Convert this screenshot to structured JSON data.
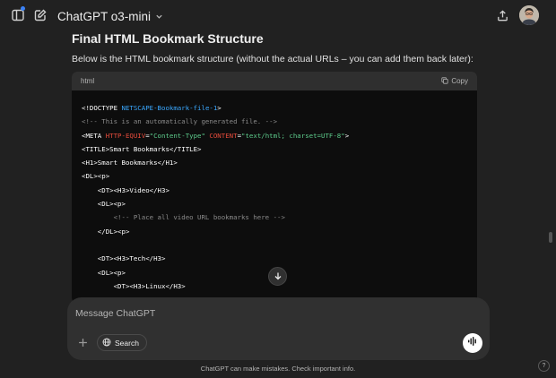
{
  "header": {
    "model_name": "ChatGPT o3-mini",
    "notification_color": "#3b82f6"
  },
  "message": {
    "heading": "Final HTML Bookmark Structure",
    "intro": "Below is the HTML bookmark structure (without the actual URLs – you can add them back later):"
  },
  "code_block": {
    "language": "html",
    "copy_label": "Copy",
    "lines": [
      [
        {
          "c": "t-tag",
          "t": "<!DOCTYPE "
        },
        {
          "c": "t-doc",
          "t": "NETSCAPE-Bookmark-file-1"
        },
        {
          "c": "t-tag",
          "t": ">"
        }
      ],
      [
        {
          "c": "t-com",
          "t": "<!-- This is an automatically generated file. -->"
        }
      ],
      [
        {
          "c": "t-tag",
          "t": "<META "
        },
        {
          "c": "t-attr",
          "t": "HTTP-EQUIV"
        },
        {
          "c": "t-tag",
          "t": "="
        },
        {
          "c": "t-str",
          "t": "\"Content-Type\""
        },
        {
          "c": "t-tag",
          "t": " "
        },
        {
          "c": "t-attr",
          "t": "CONTENT"
        },
        {
          "c": "t-tag",
          "t": "="
        },
        {
          "c": "t-str",
          "t": "\"text/html; charset=UTF-8\""
        },
        {
          "c": "t-tag",
          "t": ">"
        }
      ],
      [
        {
          "c": "t-tag",
          "t": "<TITLE>Smart Bookmarks</TITLE>"
        }
      ],
      [
        {
          "c": "t-tag",
          "t": "<H1>Smart Bookmarks</H1>"
        }
      ],
      [
        {
          "c": "t-tag",
          "t": "<DL><p>"
        }
      ],
      [
        {
          "c": "t-tag",
          "t": "    <DT><H3>Video</H3>"
        }
      ],
      [
        {
          "c": "t-tag",
          "t": "    <DL><p>"
        }
      ],
      [
        {
          "c": "t-com",
          "t": "        <!-- Place all video URL bookmarks here -->"
        }
      ],
      [
        {
          "c": "t-tag",
          "t": "    </DL><p>"
        }
      ],
      [
        {
          "c": "t-tag",
          "t": ""
        }
      ],
      [
        {
          "c": "t-tag",
          "t": "    <DT><H3>Tech</H3>"
        }
      ],
      [
        {
          "c": "t-tag",
          "t": "    <DL><p>"
        }
      ],
      [
        {
          "c": "t-tag",
          "t": "        <DT><H3>Linux</H3>"
        }
      ],
      [
        {
          "c": "t-tag",
          "t": "        <DL><p>"
        }
      ]
    ]
  },
  "composer": {
    "placeholder": "Message ChatGPT",
    "search_label": "Search"
  },
  "footer": {
    "disclaimer": "ChatGPT can make mistakes. Check important info.",
    "help_label": "?"
  },
  "icons": {
    "sidebar": "sidebar-toggle-icon",
    "new_chat": "new-chat-icon",
    "chevron": "chevron-down-icon",
    "share": "share-icon",
    "copy": "copy-icon",
    "scroll_down": "arrow-down-icon",
    "attach": "plus-icon",
    "globe": "globe-icon",
    "voice": "voice-wave-icon"
  }
}
